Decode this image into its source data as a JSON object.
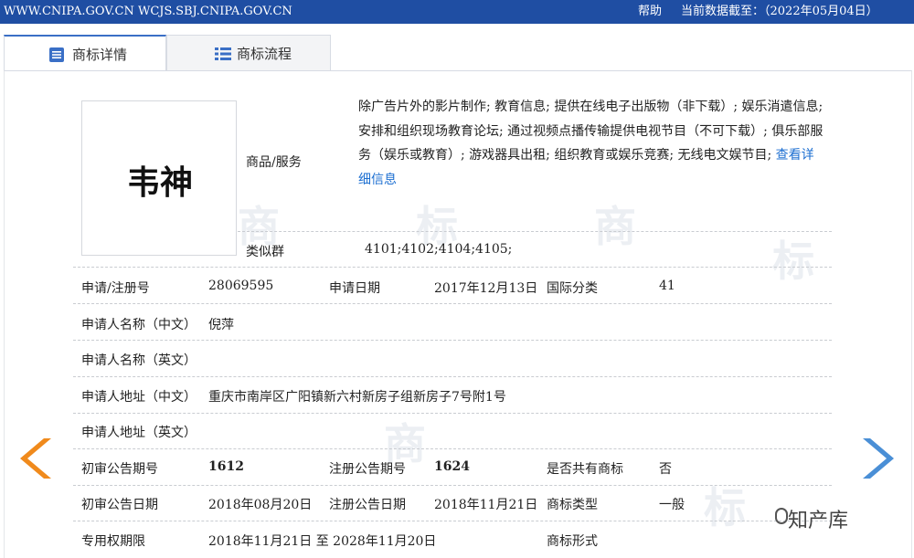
{
  "topbar": {
    "site": "WWW.CNIPA.GOV.CN WCJS.SBJ.CNIPA.GOV.CN",
    "help": "帮助",
    "date": "当前数据截至：（2022年05月04日）",
    "color": "#1f4ea3"
  },
  "tabs": [
    {
      "label": "商标详情",
      "icon": "document-list-icon",
      "active": true
    },
    {
      "label": "商标流程",
      "icon": "list-icon",
      "active": false
    }
  ],
  "trademark": {
    "name": "韦神",
    "goods_label": "商品/服务",
    "goods_text": "除广告片外的影片制作; 教育信息; 提供在线电子出版物（非下载）; 娱乐消遣信息; 安排和组织现场教育论坛; 通过视频点播传输提供电视节目（不可下载）; 俱乐部服务（娱乐或教育）; 游戏器具出租; 组织教育或娱乐竞赛; 无线电文娱节目; ",
    "goods_more": "查看详细信息",
    "similar_label": "类似群",
    "similar_value": "4101;4102;4104;4105;"
  },
  "rows": {
    "reg_no_label": "申请/注册号",
    "reg_no": "28069595",
    "apply_date_label": "申请日期",
    "apply_date": "2017年12月13日",
    "intl_class_label": "国际分类",
    "intl_class": "41",
    "applicant_cn_label": "申请人名称（中文）",
    "applicant_cn": "倪萍",
    "applicant_en_label": "申请人名称（英文）",
    "applicant_en": "",
    "address_cn_label": "申请人地址（中文）",
    "address_cn": "重庆市南岸区广阳镇新六村新房子组新房子7号附1号",
    "address_en_label": "申请人地址（英文）",
    "address_en": "",
    "prelim_no_label": "初审公告期号",
    "prelim_no": "1612",
    "reg_pub_no_label": "注册公告期号",
    "reg_pub_no": "1624",
    "shared_label": "是否共有商标",
    "shared": "否",
    "prelim_date_label": "初审公告日期",
    "prelim_date": "2018年08月20日",
    "reg_pub_date_label": "注册公告日期",
    "reg_pub_date": "2018年11月21日",
    "tm_type_label": "商标类型",
    "tm_type": "一般",
    "exclusive_label": "专用权期限",
    "exclusive": "2018年11月21日 至 2028年11月20日",
    "tm_form_label": "商标形式",
    "tm_form": ""
  },
  "watermark": {
    "chars": [
      "商",
      "标",
      "商",
      "标",
      "商",
      "标"
    ]
  },
  "nav": {
    "prev_icon": "prev-arrow-icon",
    "next_icon": "next-arrow-icon",
    "prev_color": "#f08a1c",
    "next_color": "#4a8fd6"
  },
  "brand": {
    "text": "知产库",
    "icon": "wechat-icon"
  }
}
